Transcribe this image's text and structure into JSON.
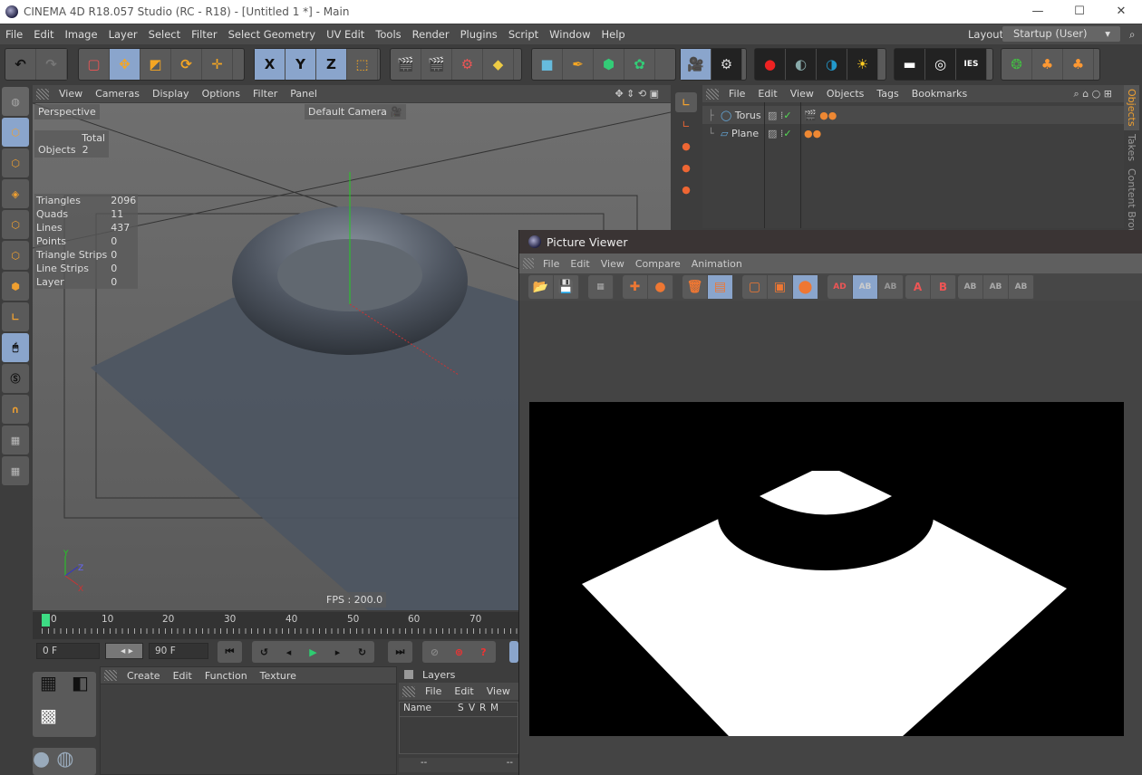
{
  "window": {
    "title": "CINEMA 4D R18.057 Studio (RC - R18) - [Untitled 1 *] - Main",
    "minimize": "—",
    "maximize": "☐",
    "close": "✕"
  },
  "menu": [
    "File",
    "Edit",
    "Image",
    "Layer",
    "Select",
    "Filter",
    "Select Geometry",
    "UV Edit",
    "Tools",
    "Render",
    "Plugins",
    "Script",
    "Window",
    "Help"
  ],
  "layout": {
    "label": "Layout:",
    "value": "Startup (User)"
  },
  "toolbar": {
    "axis": [
      "X",
      "Y",
      "Z"
    ]
  },
  "viewport": {
    "menu": [
      "View",
      "Cameras",
      "Display",
      "Options",
      "Filter",
      "Panel"
    ],
    "name": "Perspective",
    "camera": "Default Camera",
    "fps": "FPS : 200.0",
    "stats_header": "Total",
    "objects_label": "Objects",
    "objects_value": "2",
    "stats": [
      {
        "label": "Triangles",
        "value": "2096"
      },
      {
        "label": "Quads",
        "value": "11"
      },
      {
        "label": "Lines",
        "value": "437"
      },
      {
        "label": "Points",
        "value": "0"
      },
      {
        "label": "Triangle Strips",
        "value": "0"
      },
      {
        "label": "Line Strips",
        "value": "0"
      },
      {
        "label": "Layer",
        "value": "0"
      }
    ],
    "axis_labels": {
      "y": "Y",
      "z": "Z",
      "x": "X"
    }
  },
  "object_manager": {
    "menu": [
      "File",
      "Edit",
      "View",
      "Objects",
      "Tags",
      "Bookmarks"
    ],
    "objects": [
      {
        "name": "Torus"
      },
      {
        "name": "Plane"
      }
    ]
  },
  "right_tabs": [
    "Objects",
    "Takes",
    "Content Browser"
  ],
  "picture_viewer": {
    "title": "Picture Viewer",
    "menu": [
      "File",
      "Edit",
      "View",
      "Compare",
      "Animation"
    ],
    "buttons": [
      "AD",
      "AB",
      "AB",
      "A",
      "B",
      "AB",
      "AB",
      "AB"
    ]
  },
  "timeline": {
    "ticks": [
      "0",
      "10",
      "20",
      "30",
      "40",
      "50",
      "60",
      "70"
    ],
    "current_frame": 0,
    "start": "0 F",
    "end": "90 F"
  },
  "materials": {
    "menu": [
      "Create",
      "Edit",
      "Function",
      "Texture"
    ]
  },
  "layers": {
    "title": "Layers",
    "menu": [
      "File",
      "Edit",
      "View"
    ],
    "columns": [
      "Name",
      "S",
      "V",
      "R",
      "M"
    ],
    "footer_left": "--",
    "footer_right": "--"
  },
  "colors": {
    "accent": "#8aa5cc",
    "play": "#2ecc71",
    "frame_marker": "#3ddc84"
  }
}
